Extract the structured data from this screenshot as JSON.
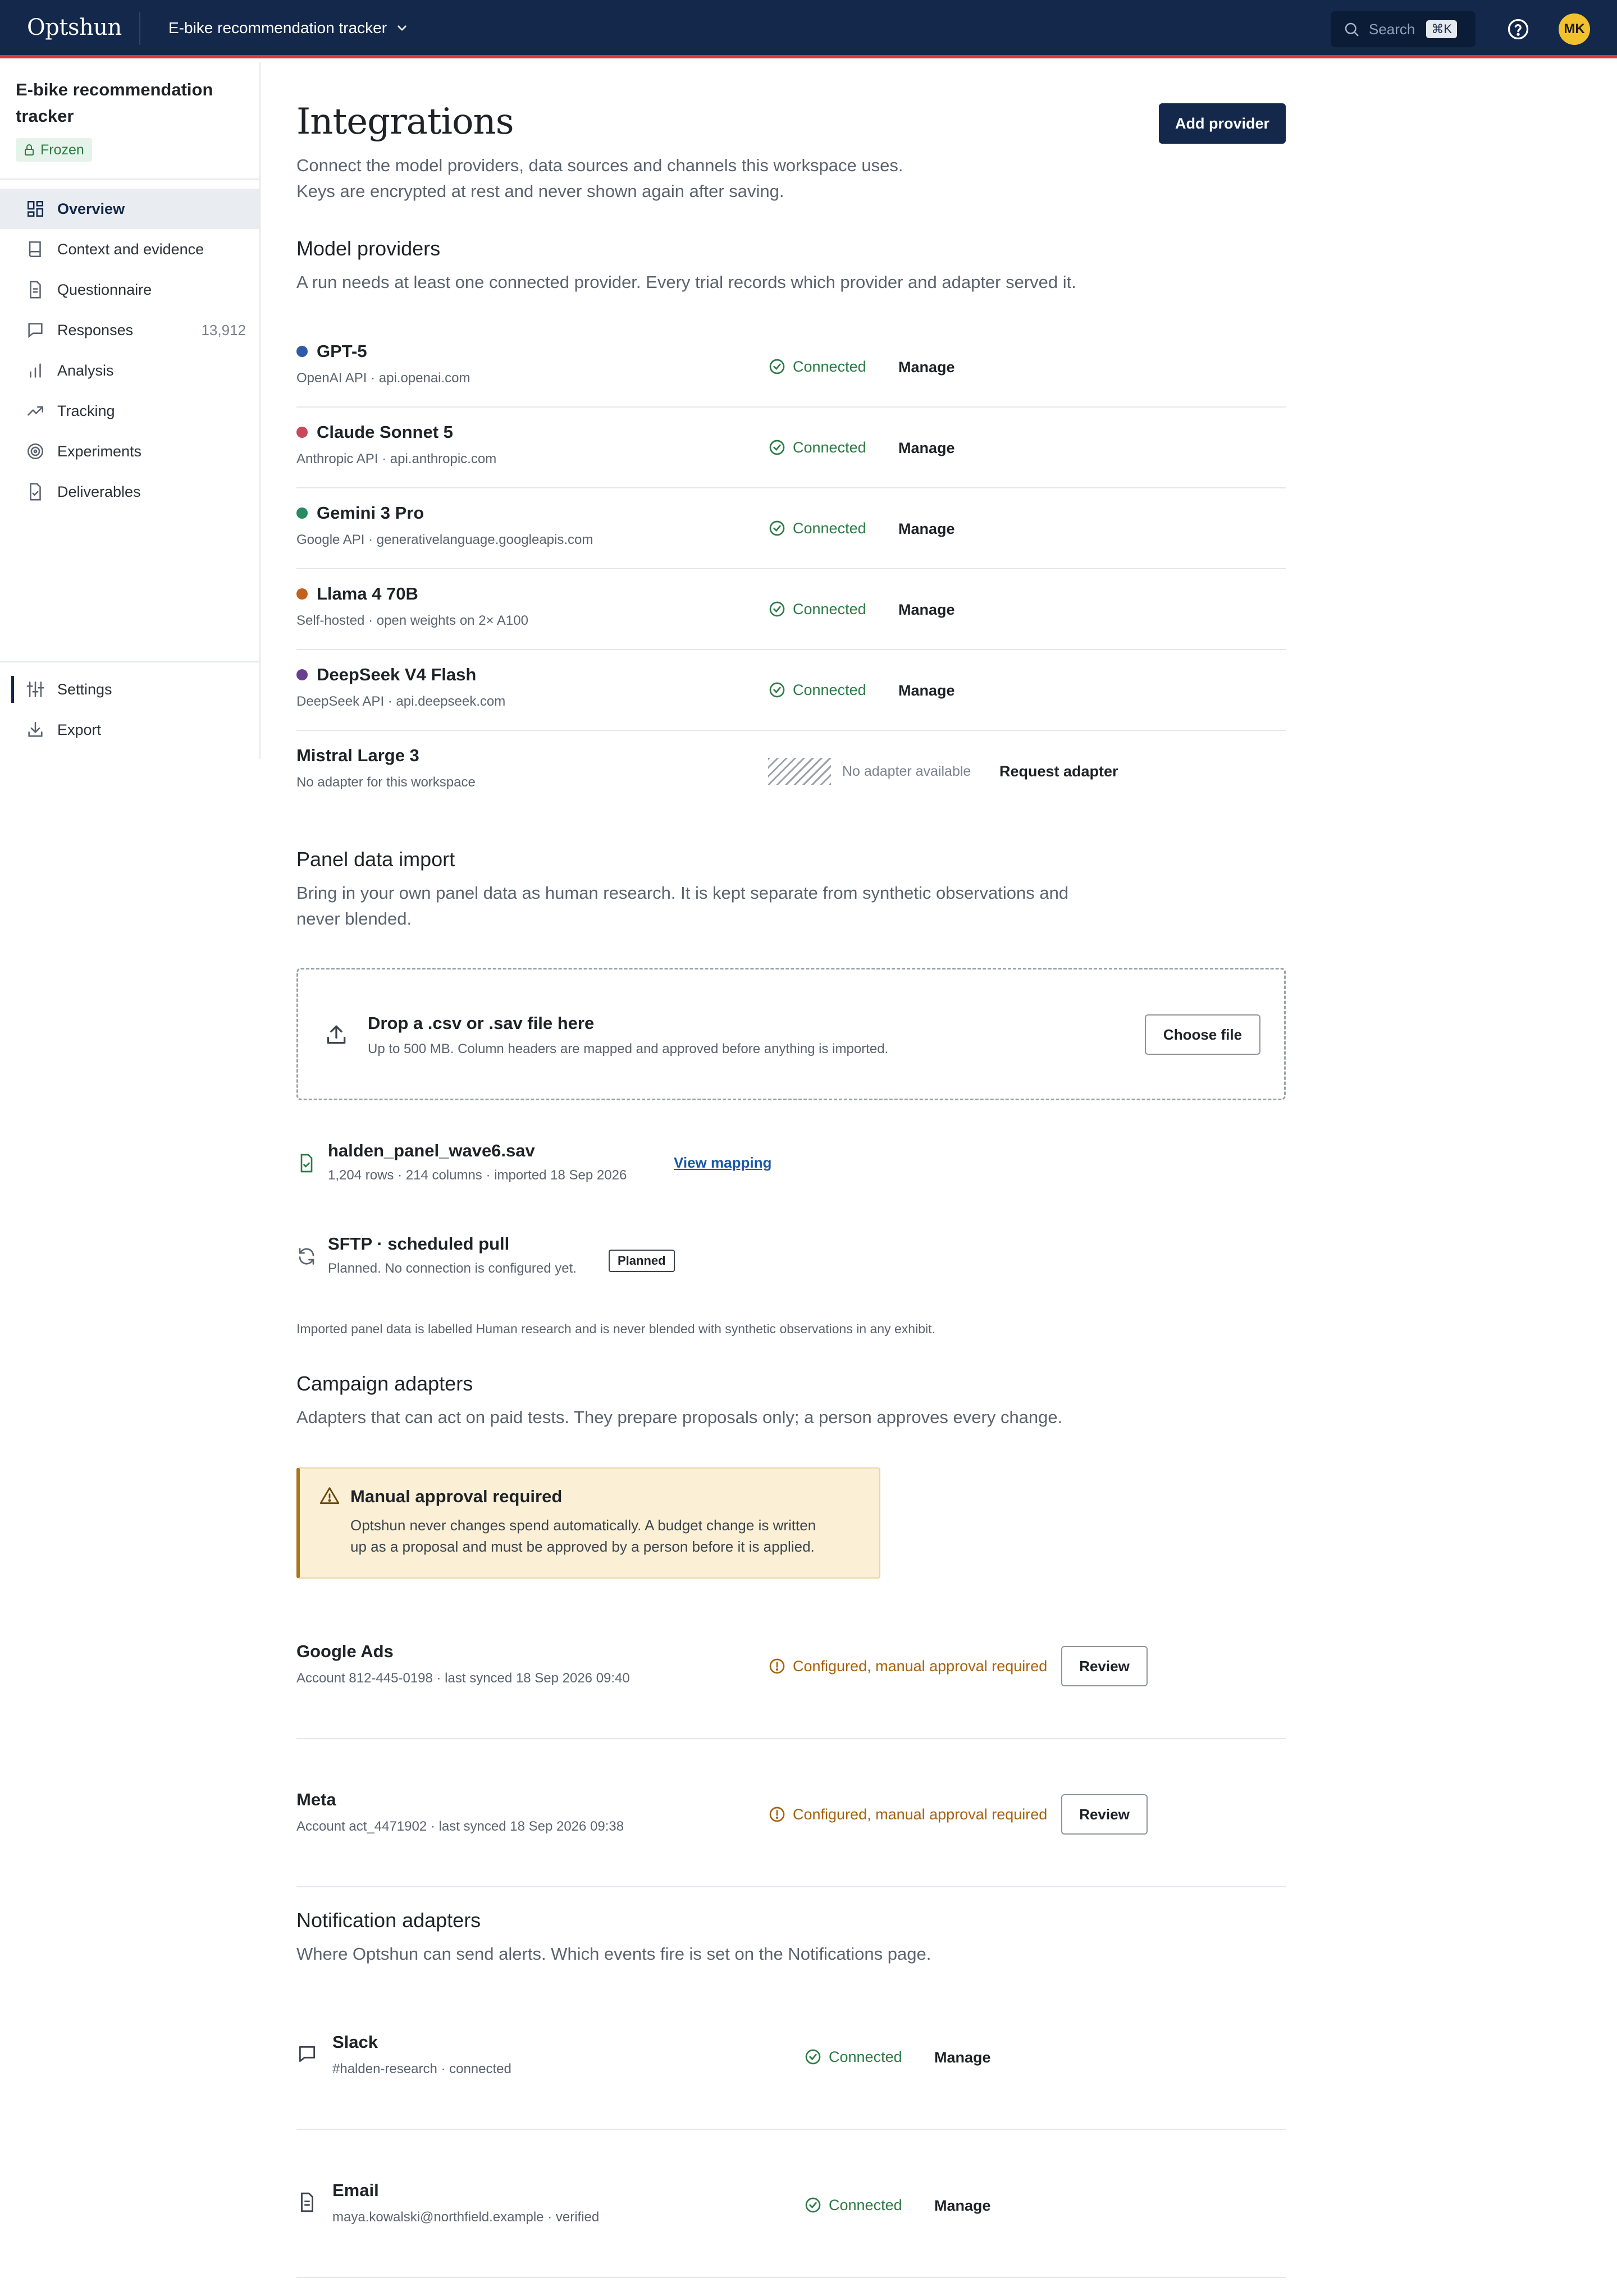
{
  "topbar": {
    "brand": "Optshun",
    "project": "E-bike recommendation tracker",
    "search_label": "Search",
    "search_shortcut": "⌘K",
    "avatar_initials": "MK"
  },
  "sidebar": {
    "title": "E-bike recommendation tracker",
    "badge": "Frozen",
    "items": [
      {
        "label": "Overview",
        "icon": "dashboard-icon"
      },
      {
        "label": "Context and evidence",
        "icon": "book-icon"
      },
      {
        "label": "Questionnaire",
        "icon": "document-icon"
      },
      {
        "label": "Responses",
        "icon": "chat-icon",
        "count": "13,912"
      },
      {
        "label": "Analysis",
        "icon": "bar-chart-icon"
      },
      {
        "label": "Tracking",
        "icon": "trend-icon"
      },
      {
        "label": "Experiments",
        "icon": "target-icon"
      },
      {
        "label": "Deliverables",
        "icon": "file-check-icon"
      }
    ],
    "bottom_items": [
      {
        "label": "Settings",
        "icon": "sliders-icon"
      },
      {
        "label": "Export",
        "icon": "download-icon"
      }
    ]
  },
  "page": {
    "title": "Integrations",
    "add_button": "Add provider",
    "subtitle_line1": "Connect the model providers, data sources and channels this workspace uses.",
    "subtitle_line2": "Keys are encrypted at rest and never shown again after saving."
  },
  "model_providers": {
    "heading": "Model providers",
    "subtitle": "A run needs at least one connected provider. Every trial records which provider and adapter served it.",
    "rows": [
      {
        "name": "GPT-5",
        "meta": "OpenAI API · api.openai.com",
        "status": "Connected",
        "action": "Manage",
        "color": "#2f5aa8"
      },
      {
        "name": "Claude Sonnet 5",
        "meta": "Anthropic API · api.anthropic.com",
        "status": "Connected",
        "action": "Manage",
        "color": "#c9485b"
      },
      {
        "name": "Gemini 3 Pro",
        "meta": "Google API · generativelanguage.googleapis.com",
        "status": "Connected",
        "action": "Manage",
        "color": "#2a8a62"
      },
      {
        "name": "Llama 4 70B",
        "meta": "Self-hosted · open weights on 2× A100",
        "status": "Connected",
        "action": "Manage",
        "color": "#c2621e"
      },
      {
        "name": "DeepSeek V4 Flash",
        "meta": "DeepSeek API · api.deepseek.com",
        "status": "Connected",
        "action": "Manage",
        "color": "#6b3f8e"
      }
    ],
    "unavailable": {
      "name": "Mistral Large 3",
      "meta": "No adapter for this workspace",
      "status": "No adapter available",
      "action": "Request adapter"
    }
  },
  "panel_import": {
    "heading": "Panel data import",
    "subtitle_line1": "Bring in your own panel data as human research. It is kept separate from synthetic observations and",
    "subtitle_line2": "never blended.",
    "drop_title": "Drop a .csv or .sav file here",
    "drop_sub": "Up to 500 MB. Column headers are mapped and approved before anything is imported.",
    "choose_button": "Choose file",
    "file_name": "halden_panel_wave6.sav",
    "file_meta": "1,204 rows · 214 columns · imported 18 Sep 2026",
    "view_mapping": "View mapping",
    "sftp_name": "SFTP · scheduled pull",
    "sftp_meta": "Planned. No connection is configured yet.",
    "sftp_badge": "Planned",
    "note": "Imported panel data is labelled Human research and is never blended with synthetic observations in any exhibit."
  },
  "campaign_adapters": {
    "heading": "Campaign adapters",
    "subtitle": "Adapters that can act on paid tests. They prepare proposals only; a person approves every change.",
    "callout_title": "Manual approval required",
    "callout_body": "Optshun never changes spend automatically. A budget change is written up as a proposal and must be approved by a person before it is applied.",
    "rows": [
      {
        "name": "Google Ads",
        "meta": "Account 812-445-0198 · last synced 18 Sep 2026 09:40",
        "status": "Configured, manual approval required",
        "action": "Review"
      },
      {
        "name": "Meta",
        "meta": "Account act_4471902 · last synced 18 Sep 2026 09:38",
        "status": "Configured, manual approval required",
        "action": "Review"
      }
    ]
  },
  "notification_adapters": {
    "heading": "Notification adapters",
    "subtitle": "Where Optshun can send alerts. Which events fire is set on the Notifications page.",
    "rows": [
      {
        "name": "Slack",
        "meta": "#halden-research · connected",
        "status": "Connected",
        "action": "Manage",
        "icon": "chat-icon"
      },
      {
        "name": "Email",
        "meta": "maya.kowalski@northfield.example · verified",
        "status": "Connected",
        "action": "Manage",
        "icon": "document-icon"
      }
    ]
  }
}
